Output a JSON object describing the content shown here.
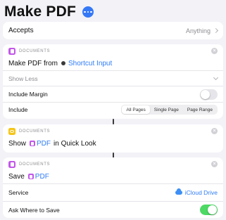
{
  "header": {
    "title": "Make PDF",
    "more_icon": "ellipsis-circle-icon"
  },
  "accepts": {
    "label": "Accepts",
    "value": "Anything"
  },
  "make_pdf_card": {
    "category": "DOCUMENTS",
    "action_text": "Make PDF from",
    "input_token": "Shortcut Input",
    "show_less": "Show Less",
    "include_margin_label": "Include Margin",
    "include_margin_on": false,
    "include_label": "Include",
    "include_options": [
      "All Pages",
      "Single Page",
      "Page Range"
    ],
    "include_selected": "All Pages"
  },
  "quick_look_card": {
    "category": "DOCUMENTS",
    "action_prefix": "Show",
    "token": "PDF",
    "action_suffix": "in Quick Look"
  },
  "save_card": {
    "category": "DOCUMENTS",
    "action_prefix": "Save",
    "token": "PDF",
    "service_label": "Service",
    "service_value": "iCloud Drive",
    "ask_label": "Ask Where to Save",
    "ask_on": true
  },
  "colors": {
    "accent": "#2f7cf6",
    "toggle_on": "#4cd964",
    "documents_icon": "#c257e8",
    "quicklook_icon": "#f5c518"
  }
}
